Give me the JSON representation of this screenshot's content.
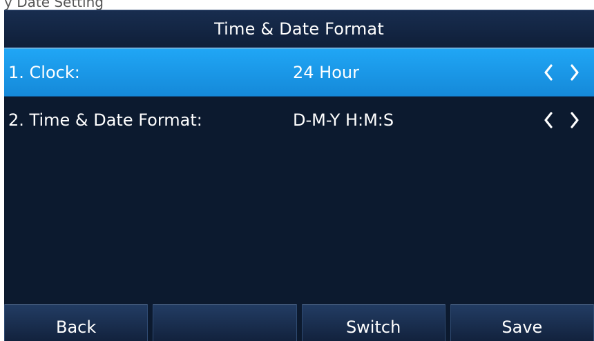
{
  "top_fragment": {
    "text": "y       Date Setting"
  },
  "title": "Time & Date Format",
  "rows": [
    {
      "label": "1. Clock:",
      "value": "24 Hour",
      "selected": true
    },
    {
      "label": "2. Time & Date Format:",
      "value": "D-M-Y H:M:S",
      "selected": false
    }
  ],
  "softkeys": [
    {
      "label": "Back"
    },
    {
      "label": ""
    },
    {
      "label": "Switch"
    },
    {
      "label": "Save"
    }
  ],
  "colors": {
    "background": "#0c1a2f",
    "selected_row": "#1d9be8",
    "text": "#ffffff",
    "arrow": "#ffffff"
  },
  "icons": {
    "left": "chevron-left-icon",
    "right": "chevron-right-icon"
  }
}
